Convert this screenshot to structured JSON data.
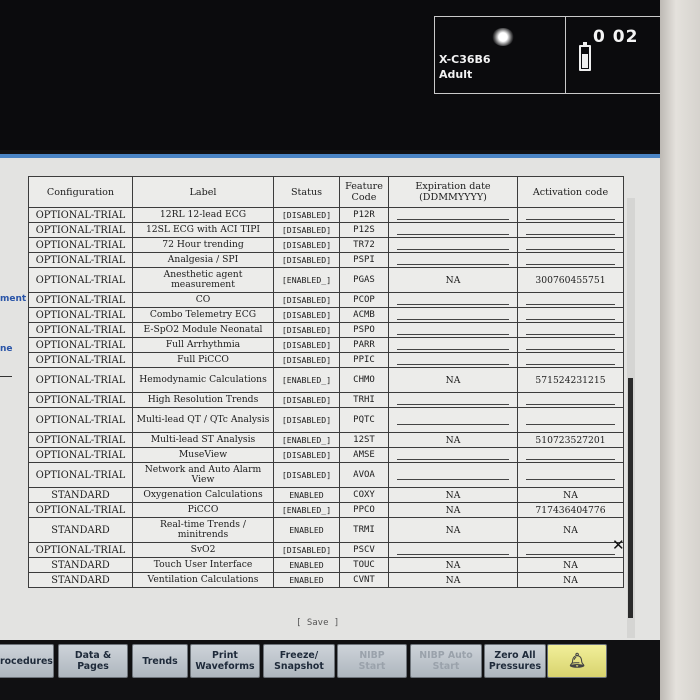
{
  "patient": {
    "id": "X-C36B6",
    "category": "Adult",
    "value": "0 02",
    "battery_icon": "battery-icon"
  },
  "sidebar": {
    "text1": "ment",
    "text2": "ne"
  },
  "table": {
    "headers": [
      "Configuration",
      "Label",
      "Status",
      "Feature\nCode",
      "Expiration date\n(DDMMYYYY)",
      "Activation code"
    ],
    "rows": [
      {
        "config": "OPTIONAL-TRIAL",
        "label": "12RL 12-lead ECG",
        "status": "[DISABLED]",
        "code": "P12R",
        "expiration": "",
        "activation": ""
      },
      {
        "config": "OPTIONAL-TRIAL",
        "label": "12SL ECG with ACI TIPI",
        "status": "[DISABLED]",
        "code": "P12S",
        "expiration": "",
        "activation": ""
      },
      {
        "config": "OPTIONAL-TRIAL",
        "label": "72 Hour trending",
        "status": "[DISABLED]",
        "code": "TR72",
        "expiration": "",
        "activation": ""
      },
      {
        "config": "OPTIONAL-TRIAL",
        "label": "Analgesia / SPI",
        "status": "[DISABLED]",
        "code": "PSPI",
        "expiration": "",
        "activation": ""
      },
      {
        "config": "OPTIONAL-TRIAL",
        "label": "Anesthetic agent measurement",
        "status": "[ENABLED_]",
        "code": "PGAS",
        "expiration": "NA",
        "activation": "300760455751"
      },
      {
        "config": "OPTIONAL-TRIAL",
        "label": "CO",
        "status": "[DISABLED]",
        "code": "PCOP",
        "expiration": "",
        "activation": ""
      },
      {
        "config": "OPTIONAL-TRIAL",
        "label": "Combo Telemetry ECG",
        "status": "[DISABLED]",
        "code": "ACMB",
        "expiration": "",
        "activation": ""
      },
      {
        "config": "OPTIONAL-TRIAL",
        "label": "E-SpO2 Module Neonatal",
        "status": "[DISABLED]",
        "code": "PSPO",
        "expiration": "",
        "activation": ""
      },
      {
        "config": "OPTIONAL-TRIAL",
        "label": "Full Arrhythmia",
        "status": "[DISABLED]",
        "code": "PARR",
        "expiration": "",
        "activation": ""
      },
      {
        "config": "OPTIONAL-TRIAL",
        "label": "Full PiCCO",
        "status": "[DISABLED]",
        "code": "PPIC",
        "expiration": "",
        "activation": ""
      },
      {
        "config": "OPTIONAL-TRIAL",
        "label": "Hemodynamic Calculations",
        "status": "[ENABLED_]",
        "code": "CHMO",
        "expiration": "NA",
        "activation": "571524231215"
      },
      {
        "config": "OPTIONAL-TRIAL",
        "label": "High Resolution Trends",
        "status": "[DISABLED]",
        "code": "TRHI",
        "expiration": "",
        "activation": ""
      },
      {
        "config": "OPTIONAL-TRIAL",
        "label": "Multi-lead QT / QTc Analysis",
        "status": "[DISABLED]",
        "code": "PQTC",
        "expiration": "",
        "activation": ""
      },
      {
        "config": "OPTIONAL-TRIAL",
        "label": "Multi-lead ST Analysis",
        "status": "[ENABLED_]",
        "code": "12ST",
        "expiration": "NA",
        "activation": "510723527201"
      },
      {
        "config": "OPTIONAL-TRIAL",
        "label": "MuseView",
        "status": "[DISABLED]",
        "code": "AMSE",
        "expiration": "",
        "activation": ""
      },
      {
        "config": "OPTIONAL-TRIAL",
        "label": "Network and Auto Alarm View",
        "status": "[DISABLED]",
        "code": "AVOA",
        "expiration": "",
        "activation": ""
      },
      {
        "config": "STANDARD",
        "label": "Oxygenation Calculations",
        "status": "ENABLED",
        "code": "COXY",
        "expiration": "NA",
        "activation": "NA"
      },
      {
        "config": "OPTIONAL-TRIAL",
        "label": "PiCCO",
        "status": "[ENABLED_]",
        "code": "PPCO",
        "expiration": "NA",
        "activation": "717436404776"
      },
      {
        "config": "STANDARD",
        "label": "Real-time Trends / minitrends",
        "status": "ENABLED",
        "code": "TRMI",
        "expiration": "NA",
        "activation": "NA"
      },
      {
        "config": "OPTIONAL-TRIAL",
        "label": "SvO2",
        "status": "[DISABLED]",
        "code": "PSCV",
        "expiration": "",
        "activation": ""
      },
      {
        "config": "STANDARD",
        "label": "Touch User Interface",
        "status": "ENABLED",
        "code": "TOUC",
        "expiration": "NA",
        "activation": "NA"
      },
      {
        "config": "STANDARD",
        "label": "Ventilation Calculations",
        "status": "ENABLED",
        "code": "CVNT",
        "expiration": "NA",
        "activation": "NA"
      }
    ]
  },
  "save_label": "[ Save ]",
  "toolbar": [
    {
      "label": "Procedures",
      "enabled": true
    },
    {
      "label": "Data &\nPages",
      "enabled": true
    },
    {
      "label": "Trends",
      "enabled": true
    },
    {
      "label": "Print\nWaveforms",
      "enabled": true
    },
    {
      "label": "Freeze/\nSnapshot",
      "enabled": true
    },
    {
      "label": "NIBP\nStart",
      "enabled": false
    },
    {
      "label": "NIBP Auto\nStart",
      "enabled": false
    },
    {
      "label": "Zero All\nPressures",
      "enabled": true
    },
    {
      "label": "",
      "enabled": true,
      "icon": "alarm-bell-icon"
    }
  ],
  "close_icon": "close-icon"
}
